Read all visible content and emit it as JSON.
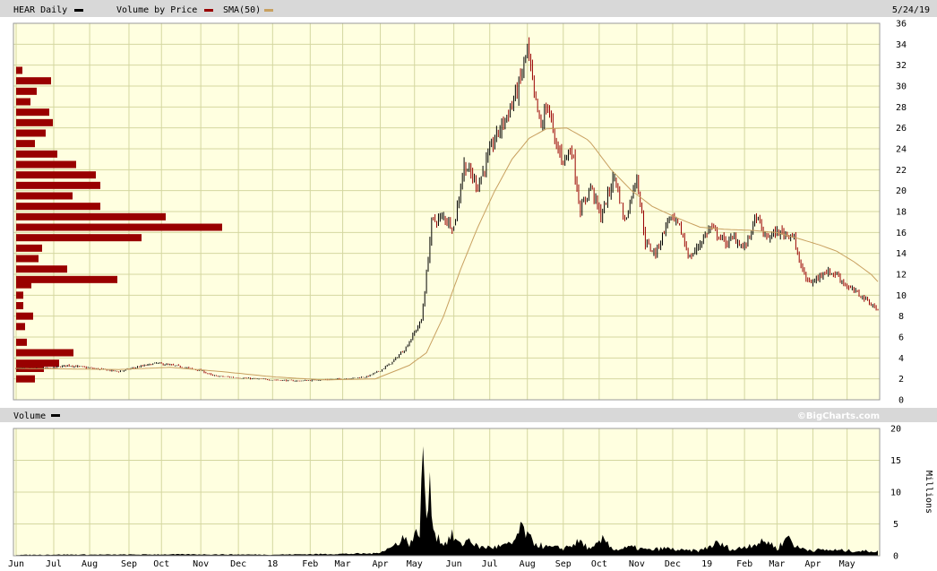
{
  "header": {
    "title": "HEAR Daily",
    "legend_vbp": "Volume by Price",
    "legend_sma": "SMA(50)",
    "date": "5/24/19"
  },
  "volume_header": {
    "title": "Volume"
  },
  "credit": "©BigCharts.com",
  "colors": {
    "plot_bg": "#ffffe0",
    "grid": "#d4d7a0",
    "up": "#000000",
    "down": "#990000",
    "vbp": "#990000",
    "sma": "#c8a060",
    "band": "#d8d8d8"
  },
  "chart_data": [
    {
      "type": "line",
      "title": "HEAR Daily",
      "ylim": [
        0,
        36
      ],
      "yticks": [
        "0",
        "2",
        "4",
        "6",
        "8",
        "10",
        "12",
        "14",
        "16",
        "18",
        "20",
        "22",
        "24",
        "26",
        "28",
        "30",
        "32",
        "34",
        "36"
      ],
      "xticks": [
        {
          "label": "Jun",
          "i": 0
        },
        {
          "label": "Jul",
          "i": 22
        },
        {
          "label": "Aug",
          "i": 43
        },
        {
          "label": "Sep",
          "i": 66
        },
        {
          "label": "Oct",
          "i": 85
        },
        {
          "label": "Nov",
          "i": 108
        },
        {
          "label": "Dec",
          "i": 130
        },
        {
          "label": "18",
          "i": 150
        },
        {
          "label": "Feb",
          "i": 172
        },
        {
          "label": "Mar",
          "i": 191
        },
        {
          "label": "Apr",
          "i": 213
        },
        {
          "label": "May",
          "i": 233
        },
        {
          "label": "Jun",
          "i": 256
        },
        {
          "label": "Jul",
          "i": 277
        },
        {
          "label": "Aug",
          "i": 299
        },
        {
          "label": "Sep",
          "i": 320
        },
        {
          "label": "Oct",
          "i": 341
        },
        {
          "label": "Nov",
          "i": 363
        },
        {
          "label": "Dec",
          "i": 384
        },
        {
          "label": "19",
          "i": 404
        },
        {
          "label": "Feb",
          "i": 426
        },
        {
          "label": "Mar",
          "i": 445
        },
        {
          "label": "Apr",
          "i": 466
        },
        {
          "label": "May",
          "i": 486
        }
      ],
      "price_anchors": [
        [
          0,
          3.0
        ],
        [
          20,
          3.0
        ],
        [
          30,
          3.3
        ],
        [
          50,
          2.9
        ],
        [
          60,
          2.7
        ],
        [
          70,
          3.1
        ],
        [
          82,
          3.5
        ],
        [
          95,
          3.2
        ],
        [
          108,
          2.8
        ],
        [
          115,
          2.3
        ],
        [
          130,
          2.1
        ],
        [
          150,
          1.9
        ],
        [
          165,
          1.8
        ],
        [
          178,
          1.9
        ],
        [
          192,
          2.0
        ],
        [
          205,
          2.2
        ],
        [
          213,
          2.8
        ],
        [
          220,
          3.6
        ],
        [
          228,
          5.0
        ],
        [
          237,
          7.6
        ],
        [
          240,
          12.0
        ],
        [
          243,
          17.0
        ],
        [
          250,
          17.5
        ],
        [
          256,
          16.5
        ],
        [
          262,
          22.5
        ],
        [
          270,
          20.5
        ],
        [
          280,
          25.0
        ],
        [
          288,
          27.5
        ],
        [
          294,
          30.0
        ],
        [
          299,
          33.5
        ],
        [
          303,
          29.0
        ],
        [
          307,
          26.0
        ],
        [
          311,
          28.5
        ],
        [
          315,
          24.5
        ],
        [
          320,
          23.0
        ],
        [
          325,
          24.0
        ],
        [
          330,
          18.0
        ],
        [
          336,
          20.5
        ],
        [
          342,
          17.5
        ],
        [
          350,
          21.5
        ],
        [
          356,
          17.0
        ],
        [
          363,
          21.5
        ],
        [
          368,
          15.0
        ],
        [
          374,
          14.0
        ],
        [
          382,
          17.5
        ],
        [
          388,
          16.5
        ],
        [
          394,
          13.5
        ],
        [
          400,
          15.0
        ],
        [
          406,
          16.5
        ],
        [
          415,
          15.0
        ],
        [
          420,
          15.5
        ],
        [
          426,
          14.5
        ],
        [
          433,
          17.5
        ],
        [
          438,
          15.5
        ],
        [
          445,
          16.0
        ],
        [
          455,
          15.8
        ],
        [
          456,
          14.2
        ],
        [
          462,
          11.5
        ],
        [
          466,
          11.2
        ],
        [
          472,
          12.3
        ],
        [
          480,
          12.0
        ],
        [
          486,
          10.8
        ],
        [
          492,
          10.2
        ],
        [
          498,
          9.5
        ],
        [
          504,
          8.5
        ]
      ],
      "sma_anchors": [
        [
          0,
          3.0
        ],
        [
          60,
          2.9
        ],
        [
          90,
          3.1
        ],
        [
          120,
          2.7
        ],
        [
          150,
          2.2
        ],
        [
          180,
          1.9
        ],
        [
          210,
          2.0
        ],
        [
          230,
          3.3
        ],
        [
          240,
          4.5
        ],
        [
          250,
          8.0
        ],
        [
          260,
          12.5
        ],
        [
          270,
          16.5
        ],
        [
          280,
          20.0
        ],
        [
          290,
          23.0
        ],
        [
          300,
          25.0
        ],
        [
          310,
          25.9
        ],
        [
          322,
          26.0
        ],
        [
          335,
          24.8
        ],
        [
          348,
          22.0
        ],
        [
          360,
          20.0
        ],
        [
          372,
          18.5
        ],
        [
          385,
          17.5
        ],
        [
          400,
          16.5
        ],
        [
          415,
          16.3
        ],
        [
          430,
          16.2
        ],
        [
          445,
          16.0
        ],
        [
          460,
          15.3
        ],
        [
          470,
          14.8
        ],
        [
          480,
          14.2
        ],
        [
          490,
          13.2
        ],
        [
          500,
          12.0
        ],
        [
          504,
          11.3
        ]
      ]
    },
    {
      "type": "bar",
      "title": "Volume by Price",
      "bins": [
        {
          "price": 2,
          "width": 21
        },
        {
          "price": 3,
          "width": 31
        },
        {
          "price": 3.5,
          "width": 48
        },
        {
          "price": 4.5,
          "width": 64
        },
        {
          "price": 5.5,
          "width": 12
        },
        {
          "price": 7,
          "width": 10
        },
        {
          "price": 8,
          "width": 19
        },
        {
          "price": 9,
          "width": 8
        },
        {
          "price": 10,
          "width": 8
        },
        {
          "price": 11,
          "width": 17
        },
        {
          "price": 11.5,
          "width": 113
        },
        {
          "price": 12.5,
          "width": 57
        },
        {
          "price": 13.5,
          "width": 25
        },
        {
          "price": 14.5,
          "width": 29
        },
        {
          "price": 15.5,
          "width": 140
        },
        {
          "price": 16.5,
          "width": 230
        },
        {
          "price": 17.5,
          "width": 167
        },
        {
          "price": 18.5,
          "width": 94
        },
        {
          "price": 19.5,
          "width": 63
        },
        {
          "price": 20.5,
          "width": 94
        },
        {
          "price": 21.5,
          "width": 89
        },
        {
          "price": 22.5,
          "width": 67
        },
        {
          "price": 23.5,
          "width": 46
        },
        {
          "price": 24.5,
          "width": 21
        },
        {
          "price": 25.5,
          "width": 33
        },
        {
          "price": 26.5,
          "width": 41
        },
        {
          "price": 27.5,
          "width": 37
        },
        {
          "price": 28.5,
          "width": 16
        },
        {
          "price": 29.5,
          "width": 23
        },
        {
          "price": 30.5,
          "width": 39
        },
        {
          "price": 31.5,
          "width": 7
        }
      ]
    },
    {
      "type": "area",
      "title": "Volume",
      "ylabel": "Millions",
      "ylim": [
        0,
        20
      ],
      "yticks": [
        "0",
        "5",
        "10",
        "15",
        "20"
      ],
      "volume_anchors": [
        [
          0,
          0.15
        ],
        [
          20,
          0.2
        ],
        [
          60,
          0.2
        ],
        [
          100,
          0.25
        ],
        [
          150,
          0.2
        ],
        [
          210,
          0.4
        ],
        [
          220,
          1.5
        ],
        [
          226,
          3.2
        ],
        [
          230,
          2.2
        ],
        [
          236,
          4.5
        ],
        [
          238,
          17.0
        ],
        [
          240,
          7.0
        ],
        [
          242,
          11.0
        ],
        [
          245,
          4.0
        ],
        [
          250,
          2.0
        ],
        [
          255,
          3.5
        ],
        [
          260,
          1.8
        ],
        [
          265,
          3.0
        ],
        [
          270,
          1.5
        ],
        [
          280,
          1.5
        ],
        [
          290,
          2.0
        ],
        [
          296,
          5.0
        ],
        [
          300,
          3.0
        ],
        [
          305,
          2.0
        ],
        [
          310,
          1.5
        ],
        [
          320,
          1.3
        ],
        [
          330,
          2.5
        ],
        [
          336,
          1.0
        ],
        [
          344,
          3.0
        ],
        [
          350,
          1.0
        ],
        [
          360,
          1.5
        ],
        [
          370,
          1.0
        ],
        [
          380,
          1.3
        ],
        [
          390,
          0.9
        ],
        [
          400,
          0.9
        ],
        [
          410,
          2.2
        ],
        [
          420,
          1.0
        ],
        [
          430,
          2.0
        ],
        [
          440,
          2.5
        ],
        [
          445,
          1.2
        ],
        [
          452,
          3.5
        ],
        [
          456,
          1.5
        ],
        [
          465,
          1.0
        ],
        [
          475,
          1.0
        ],
        [
          485,
          0.9
        ],
        [
          495,
          0.8
        ],
        [
          504,
          0.8
        ]
      ]
    }
  ]
}
